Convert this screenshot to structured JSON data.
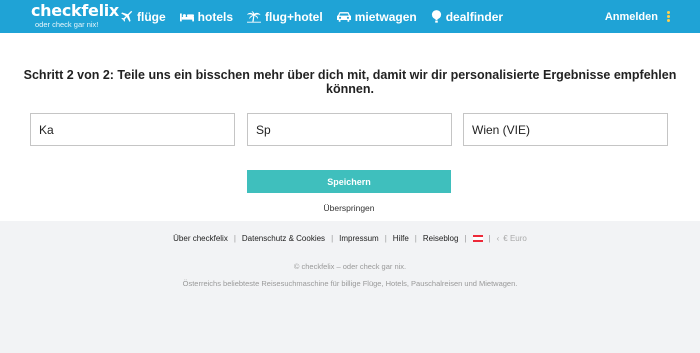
{
  "header": {
    "logo": "checkfelix",
    "logo_tagline": "oder check gar nix!",
    "nav": [
      {
        "label": "flüge",
        "icon": "plane-icon"
      },
      {
        "label": "hotels",
        "icon": "bed-icon"
      },
      {
        "label": "flug+hotel",
        "icon": "palm-tree-icon"
      },
      {
        "label": "mietwagen",
        "icon": "car-icon"
      },
      {
        "label": "dealfinder",
        "icon": "balloon-icon"
      }
    ],
    "login_label": "Anmelden",
    "colors": {
      "background": "#1fa3d6",
      "accent": "#ffd04a"
    }
  },
  "main": {
    "title": "Schritt 2 von 2: Teile uns ein bisschen mehr über dich mit, damit wir dir personalisierte Ergebnisse empfehlen können.",
    "fields": [
      {
        "value": "Ka"
      },
      {
        "value": "Sp"
      },
      {
        "value": "Wien (VIE)"
      }
    ],
    "save_label": "Speichern",
    "skip_label": "Überspringen",
    "colors": {
      "button": "#3fbfbd"
    }
  },
  "footer": {
    "links": [
      "Über checkfelix",
      "Datenschutz & Cookies",
      "Impressum",
      "Hilfe",
      "Reiseblog"
    ],
    "currency": "€ Euro",
    "copyright": "© checkfelix – oder check gar nix.",
    "tagline": "Österreichs beliebteste Reisesuchmaschine für billige Flüge, Hotels, Pauschalreisen und Mietwagen."
  }
}
